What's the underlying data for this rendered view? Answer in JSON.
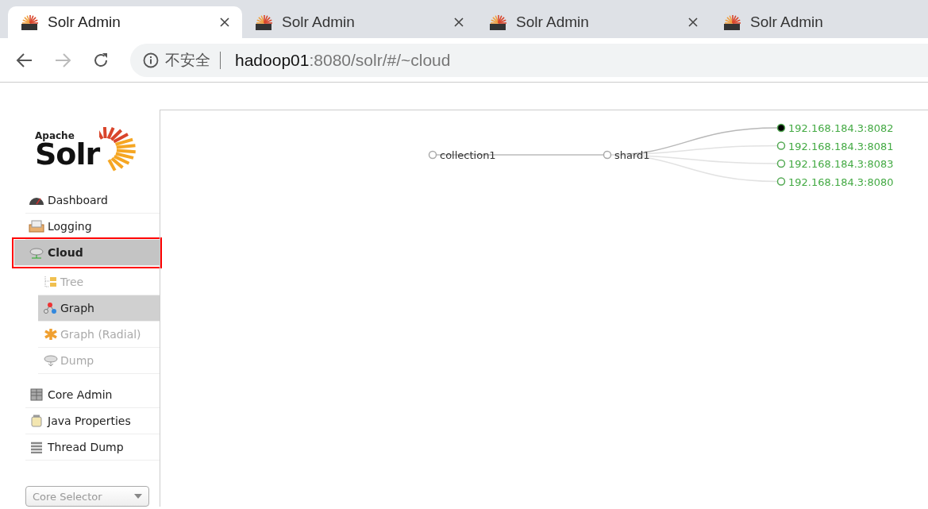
{
  "tabs": [
    {
      "title": "Solr Admin",
      "selected": true,
      "show_close": true
    },
    {
      "title": "Solr Admin",
      "selected": false,
      "show_close": true
    },
    {
      "title": "Solr Admin",
      "selected": false,
      "show_close": true
    },
    {
      "title": "Solr Admin",
      "selected": false,
      "show_close": false
    }
  ],
  "address_bar": {
    "security_label": "不安全",
    "host": "hadoop01",
    "path": ":8080/solr/#/~cloud"
  },
  "logo": {
    "small": "Apache",
    "name": "Solr"
  },
  "sidebar": {
    "items": [
      {
        "label": "Dashboard",
        "selected": false,
        "highlighted": false
      },
      {
        "label": "Logging",
        "selected": false,
        "highlighted": false
      },
      {
        "label": "Cloud",
        "selected": true,
        "highlighted": true,
        "children": [
          {
            "label": "Tree",
            "selected": false
          },
          {
            "label": "Graph",
            "selected": true
          },
          {
            "label": "Graph (Radial)",
            "selected": false
          },
          {
            "label": "Dump",
            "selected": false
          }
        ]
      },
      {
        "label": "Core Admin",
        "selected": false,
        "highlighted": false
      },
      {
        "label": "Java Properties",
        "selected": false,
        "highlighted": false
      },
      {
        "label": "Thread Dump",
        "selected": false,
        "highlighted": false
      }
    ],
    "core_selector": {
      "placeholder": "Core Selector"
    }
  },
  "graph": {
    "collection": "collection1",
    "shard": "shard1",
    "replicas": [
      {
        "label": "192.168.184.3:8082",
        "leader": true
      },
      {
        "label": "192.168.184.3:8081",
        "leader": false
      },
      {
        "label": "192.168.184.3:8083",
        "leader": false
      },
      {
        "label": "192.168.184.3:8080",
        "leader": false
      }
    ]
  }
}
